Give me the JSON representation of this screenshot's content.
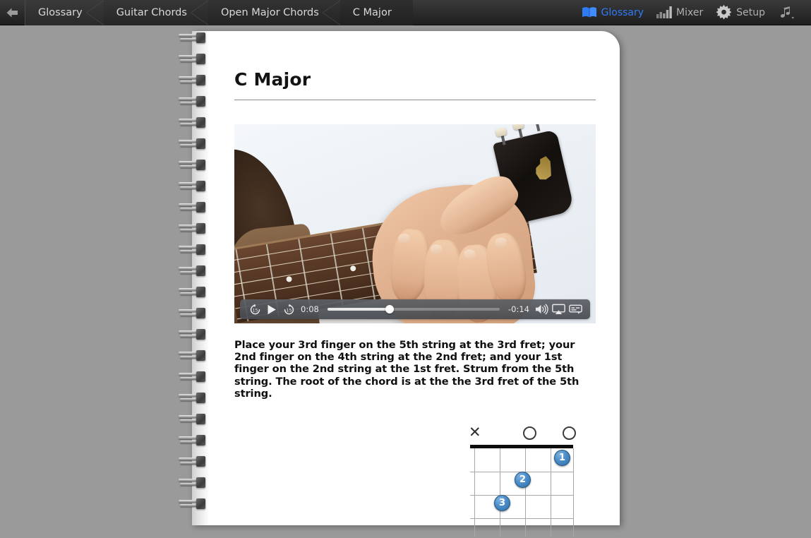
{
  "toolbar": {
    "back_icon": "back-arrow-icon",
    "breadcrumbs": [
      {
        "label": "Glossary"
      },
      {
        "label": "Guitar Chords"
      },
      {
        "label": "Open Major Chords"
      },
      {
        "label": "C Major"
      }
    ],
    "right_items": [
      {
        "label": "Glossary",
        "icon": "book-icon",
        "active": true,
        "accent": "#2f7bf6"
      },
      {
        "label": "Mixer",
        "icon": "mixer-icon",
        "active": false
      },
      {
        "label": "Setup",
        "icon": "gear-icon",
        "active": false
      },
      {
        "label": "",
        "icon": "music-note-icon",
        "active": false
      }
    ]
  },
  "page": {
    "title": "C Major",
    "body": "Place your 3rd finger on the 5th string at the 3rd fret; your 2nd finger on the 4th string at the 2nd fret; and your 1st finger on the 2nd string at the 1st fret. Strum from the 5th string. The root of the chord is at the the 3rd fret of the 5th string."
  },
  "video": {
    "alt": "Hand fretting a C major chord on an acoustic guitar neck",
    "controls": {
      "skip_back_label": "15",
      "skip_forward_label": "15",
      "play_icon": "play-icon",
      "elapsed": "0:08",
      "remaining": "-0:14",
      "progress_percent": 36,
      "volume_icon": "volume-icon",
      "airplay_icon": "airplay-icon",
      "subtitles_icon": "subtitles-icon"
    }
  },
  "chord_diagram": {
    "name": "C Major",
    "strings": 6,
    "frets": 4,
    "open_strings": [
      "3",
      "5"
    ],
    "muted_strings": [
      "6"
    ],
    "fingerings": [
      {
        "finger": "1",
        "string": 2,
        "fret": 1
      },
      {
        "finger": "2",
        "string": 4,
        "fret": 2
      },
      {
        "finger": "3",
        "string": 5,
        "fret": 3
      }
    ]
  },
  "colors": {
    "desktop_bg": "#9a9a9a",
    "toolbar_bg": "#2a2a2a",
    "accent_blue": "#2f7bf6",
    "dot_blue": "#4b8dc8",
    "page_bg": "#ffffff"
  }
}
